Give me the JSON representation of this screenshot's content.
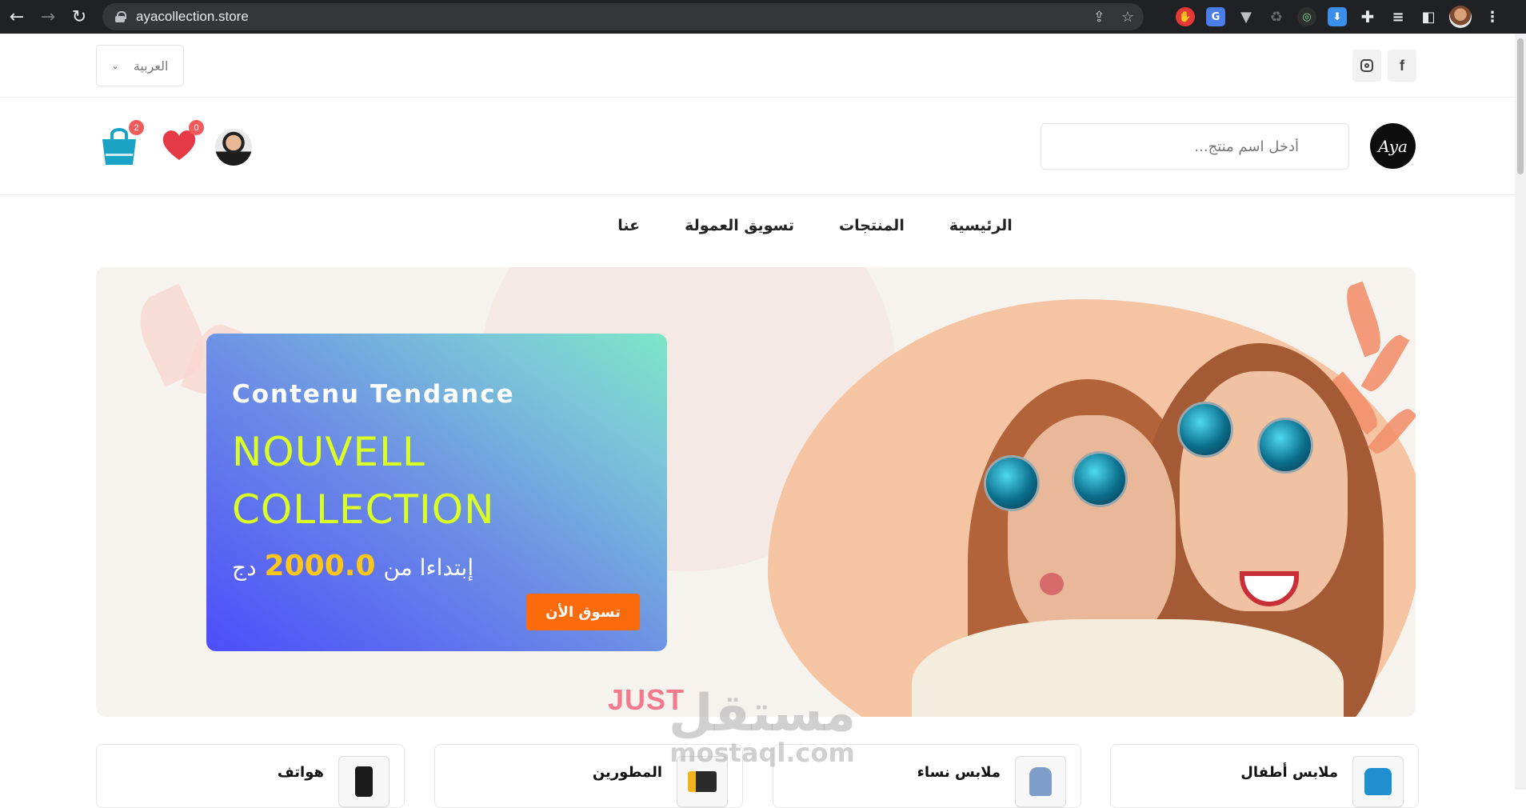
{
  "browser": {
    "url": "ayacollection.store",
    "back_glyph": "←",
    "forward_glyph": "→",
    "reload_glyph": "↻"
  },
  "topbar": {
    "language": "العربية",
    "social": [
      "facebook-icon",
      "instagram-icon"
    ]
  },
  "header": {
    "logo_text": "Aya",
    "search_placeholder": "أدخل اسم منتج...",
    "wishlist_count": "0",
    "cart_count": "2"
  },
  "nav": {
    "items": [
      "الرئيسية",
      "المنتجات",
      "تسويق العمولة",
      "عنا"
    ]
  },
  "hero": {
    "kicker": "Contenu Tendance",
    "title_line1": "NOUVELL",
    "title_line2": "COLLECTION",
    "price_prefix": "إبتداءا من",
    "price": "2000.0",
    "currency": "دج",
    "button": "تسوق الأن",
    "background_text": "JUST"
  },
  "watermark": {
    "ar": "مستقل",
    "en": "mostaql.com"
  },
  "categories": [
    "ملابس أطفال",
    "ملابس نساء",
    "المطورين",
    "هواتف"
  ],
  "colors": {
    "accent": "#fb6b0b",
    "title_lime": "#dbff25",
    "price_yellow": "#ffc61a",
    "cart_teal": "#1aa3c4",
    "heart_red": "#e63946",
    "badge_red": "#f25b5b"
  }
}
